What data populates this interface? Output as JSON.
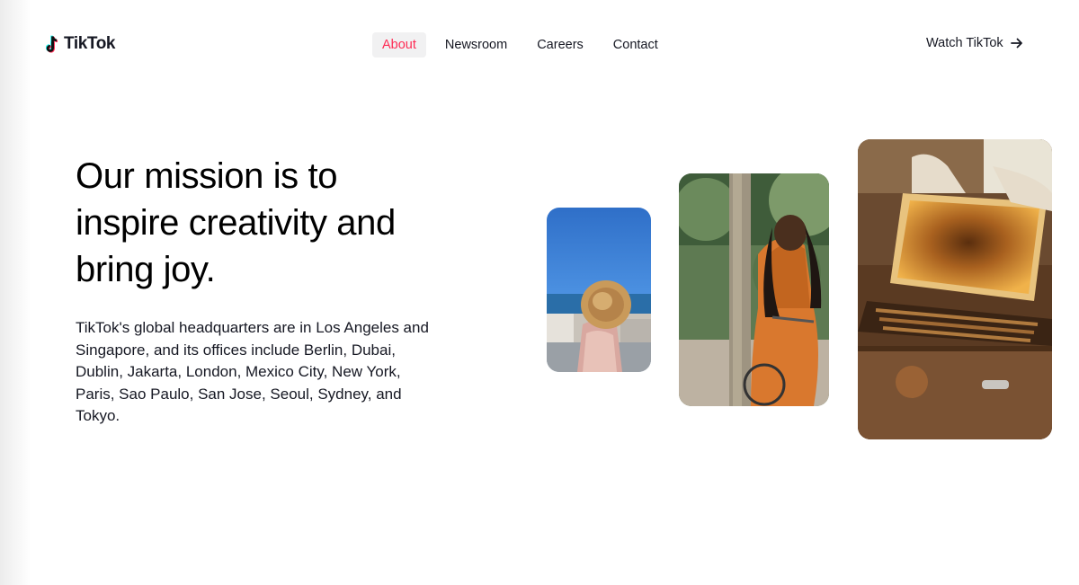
{
  "header": {
    "logo_text": "TikTok",
    "nav": [
      {
        "label": "About",
        "active": true
      },
      {
        "label": "Newsroom",
        "active": false
      },
      {
        "label": "Careers",
        "active": false
      },
      {
        "label": "Contact",
        "active": false
      }
    ],
    "cta_label": "Watch TikTok",
    "cta_icon": "arrow-right-icon"
  },
  "hero": {
    "headline": "Our mission is to inspire creativity and bring joy.",
    "body": "TikTok's global headquarters are in Los Angeles and Singapore, and its offices include Berlin, Dubai, Dublin, Jakarta, London, Mexico City, New York, Paris, Sao Paulo, San Jose, Seoul, Sydney, and Tokyo."
  },
  "colors": {
    "active_nav_text": "#fe2c55",
    "active_nav_bg": "#f1f1f2",
    "text": "#161823",
    "logo_cyan": "#25f4ee",
    "logo_red": "#fe2c55"
  }
}
